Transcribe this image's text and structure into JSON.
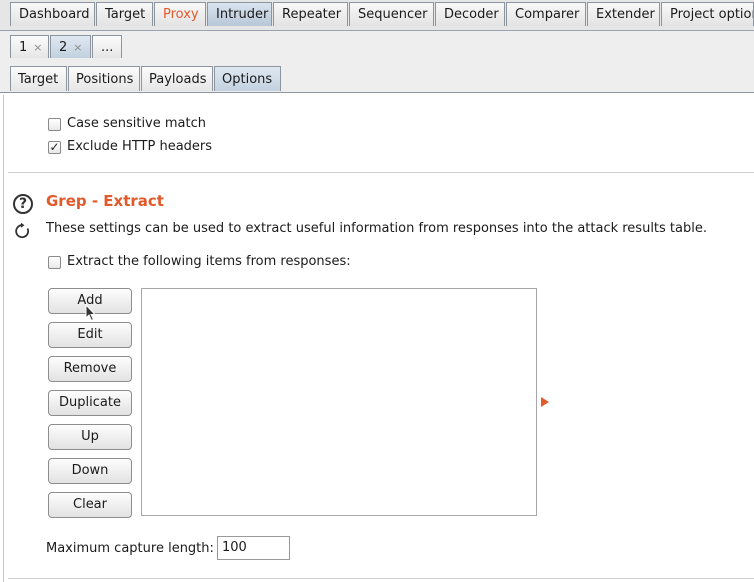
{
  "top_tabs": [
    {
      "label": "Dashboard"
    },
    {
      "label": "Target"
    },
    {
      "label": "Proxy"
    },
    {
      "label": "Intruder"
    },
    {
      "label": "Repeater"
    },
    {
      "label": "Sequencer"
    },
    {
      "label": "Decoder"
    },
    {
      "label": "Comparer"
    },
    {
      "label": "Extender"
    },
    {
      "label": "Project option"
    }
  ],
  "attack_tabs": [
    {
      "label": "1",
      "close": "×"
    },
    {
      "label": "2",
      "close": "×"
    },
    {
      "label": "..."
    }
  ],
  "sub_tabs": [
    {
      "label": "Target"
    },
    {
      "label": "Positions"
    },
    {
      "label": "Payloads"
    },
    {
      "label": "Options"
    }
  ],
  "match_options": {
    "case_sensitive_label": "Case sensitive match",
    "case_sensitive_checked": false,
    "exclude_headers_label": "Exclude HTTP headers",
    "exclude_headers_checked": true,
    "check_mark": "✓"
  },
  "grep_extract": {
    "help_glyph": "?",
    "title": "Grep - Extract",
    "description": "These settings can be used to extract useful information from responses into the attack results table.",
    "extract_label": "Extract the following items from responses:",
    "extract_checked": false,
    "buttons": {
      "add": "Add",
      "edit": "Edit",
      "remove": "Remove",
      "duplicate": "Duplicate",
      "up": "Up",
      "down": "Down",
      "clear": "Clear"
    },
    "max_capture_label": "Maximum capture length:",
    "max_capture_value": "100"
  },
  "colors": {
    "accent": "#e2592a",
    "active_tab": "#c2d1df"
  }
}
